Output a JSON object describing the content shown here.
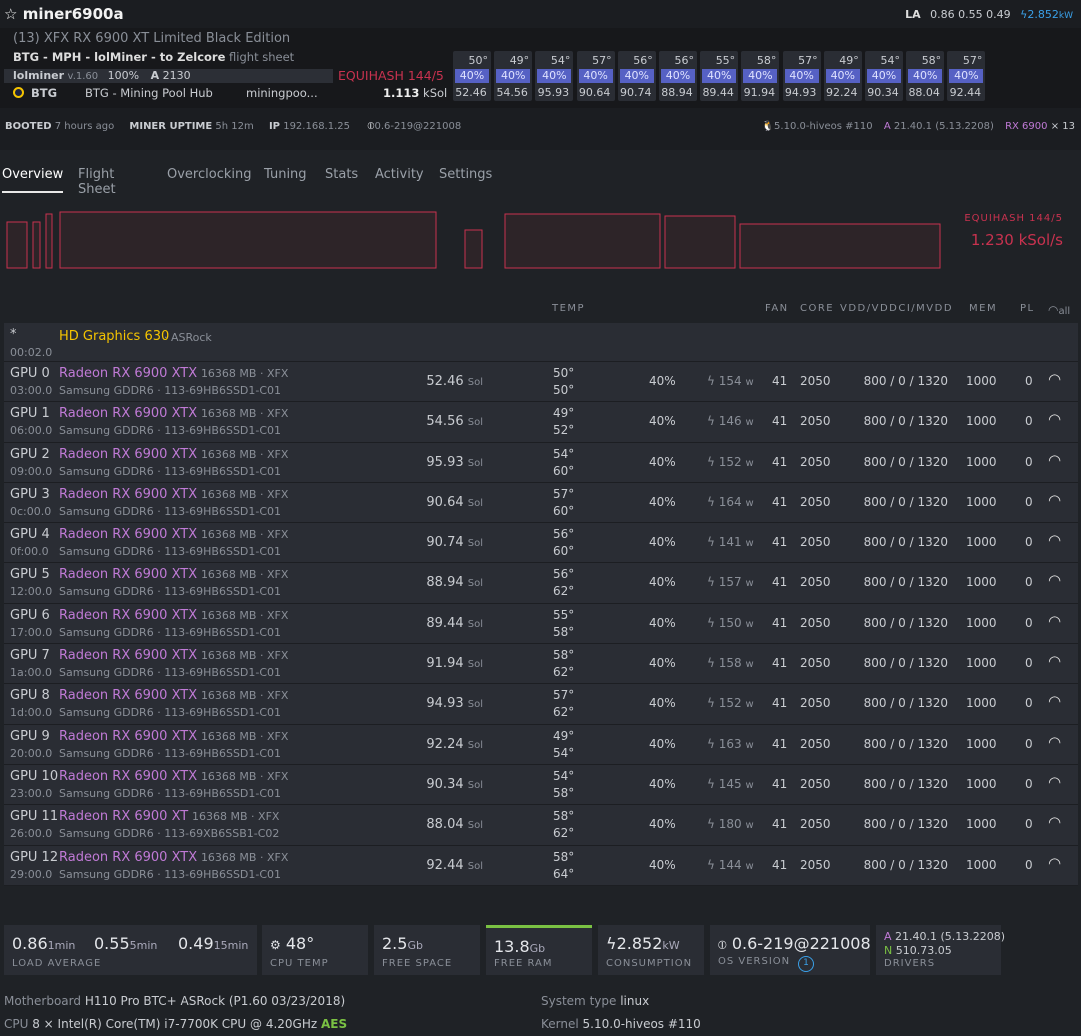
{
  "header": {
    "star_icon": "star-outline",
    "title": "miner6900a",
    "la_label": "LA",
    "la_values": "0.86 0.55 0.49",
    "power": "2.852",
    "power_unit": "kW"
  },
  "rig": {
    "model": "(13) XFX RX 6900 XT Limited Black Edition",
    "flight_sheet_name": "BTG - MPH - lolMiner - to Zelcore",
    "flight_sheet_suffix": "flight sheet",
    "miner": "lolminer",
    "miner_version": "v.1.60",
    "miner_percent": "100%",
    "accepted_label": "A",
    "accepted": "2130",
    "algo": "EQUIHASH 144/5",
    "coin": "BTG",
    "pool": "BTG - Mining Pool Hub",
    "pool_url": "miningpoo...",
    "hashrate": "1.113",
    "hashrate_unit": "kSol"
  },
  "status": {
    "booted_label": "BOOTED",
    "booted": "7 hours ago",
    "uptime_label": "MINER UPTIME",
    "uptime": "5h 12m",
    "ip_label": "IP",
    "ip": "192.168.1.25",
    "os": "0.6-219@221008",
    "kernel": "5.10.0-hiveos #110",
    "amd_label": "A",
    "amd_driver": "21.40.1 (5.13.2208)",
    "gpu_summary": "RX 6900",
    "gpu_count": "× 13"
  },
  "tiles": [
    {
      "temp": "50°",
      "fan": "40%",
      "hash": "52.46"
    },
    {
      "temp": "49°",
      "fan": "40%",
      "hash": "54.56"
    },
    {
      "temp": "54°",
      "fan": "40%",
      "hash": "95.93"
    },
    {
      "temp": "57°",
      "fan": "40%",
      "hash": "90.64"
    },
    {
      "temp": "56°",
      "fan": "40%",
      "hash": "90.74"
    },
    {
      "temp": "56°",
      "fan": "40%",
      "hash": "88.94"
    },
    {
      "temp": "55°",
      "fan": "40%",
      "hash": "89.44"
    },
    {
      "temp": "58°",
      "fan": "40%",
      "hash": "91.94"
    },
    {
      "temp": "57°",
      "fan": "40%",
      "hash": "94.93"
    },
    {
      "temp": "49°",
      "fan": "40%",
      "hash": "92.24"
    },
    {
      "temp": "54°",
      "fan": "40%",
      "hash": "90.34"
    },
    {
      "temp": "58°",
      "fan": "40%",
      "hash": "88.04"
    },
    {
      "temp": "57°",
      "fan": "40%",
      "hash": "92.44"
    }
  ],
  "tabs": [
    "Overview",
    "Flight Sheet",
    "Overclocking",
    "Tuning",
    "Stats",
    "Activity",
    "Settings"
  ],
  "graph": {
    "algo": "EQUIHASH 144/5",
    "hashrate": "1.230 kSol/s"
  },
  "columns": {
    "temp": "TEMP",
    "fan": "FAN",
    "core": "CORE",
    "vdd": "VDD/VDDCI/MVDD",
    "mem": "MEM",
    "pl": "PL",
    "all": "all"
  },
  "igpu": {
    "id": "*",
    "bus": "00:02.0",
    "name": "HD Graphics 630",
    "vendor": "· ASRock"
  },
  "gpus": [
    {
      "id": "GPU 0",
      "bus": "03:00.0",
      "name": "Radeon RX 6900 XTX",
      "mem": "16368 MB · XFX",
      "sub": "Samsung GDDR6 · 113-69HB6SSD1-C01",
      "hash": "52.46",
      "unit": "Sol",
      "t1": "50°",
      "t2": "50°",
      "fan": "40%",
      "power": "154",
      "fanv": "41",
      "core": "2050",
      "vdd": "800 / 0 / 1320",
      "memclk": "1000",
      "pl": "0"
    },
    {
      "id": "GPU 1",
      "bus": "06:00.0",
      "name": "Radeon RX 6900 XTX",
      "mem": "16368 MB · XFX",
      "sub": "Samsung GDDR6 · 113-69HB6SSD1-C01",
      "hash": "54.56",
      "unit": "Sol",
      "t1": "49°",
      "t2": "52°",
      "fan": "40%",
      "power": "146",
      "fanv": "41",
      "core": "2050",
      "vdd": "800 / 0 / 1320",
      "memclk": "1000",
      "pl": "0"
    },
    {
      "id": "GPU 2",
      "bus": "09:00.0",
      "name": "Radeon RX 6900 XTX",
      "mem": "16368 MB · XFX",
      "sub": "Samsung GDDR6 · 113-69HB6SSD1-C01",
      "hash": "95.93",
      "unit": "Sol",
      "t1": "54°",
      "t2": "60°",
      "fan": "40%",
      "power": "152",
      "fanv": "41",
      "core": "2050",
      "vdd": "800 / 0 / 1320",
      "memclk": "1000",
      "pl": "0"
    },
    {
      "id": "GPU 3",
      "bus": "0c:00.0",
      "name": "Radeon RX 6900 XTX",
      "mem": "16368 MB · XFX",
      "sub": "Samsung GDDR6 · 113-69HB6SSD1-C01",
      "hash": "90.64",
      "unit": "Sol",
      "t1": "57°",
      "t2": "60°",
      "fan": "40%",
      "power": "164",
      "fanv": "41",
      "core": "2050",
      "vdd": "800 / 0 / 1320",
      "memclk": "1000",
      "pl": "0"
    },
    {
      "id": "GPU 4",
      "bus": "0f:00.0",
      "name": "Radeon RX 6900 XTX",
      "mem": "16368 MB · XFX",
      "sub": "Samsung GDDR6 · 113-69HB6SSD1-C01",
      "hash": "90.74",
      "unit": "Sol",
      "t1": "56°",
      "t2": "60°",
      "fan": "40%",
      "power": "141",
      "fanv": "41",
      "core": "2050",
      "vdd": "800 / 0 / 1320",
      "memclk": "1000",
      "pl": "0"
    },
    {
      "id": "GPU 5",
      "bus": "12:00.0",
      "name": "Radeon RX 6900 XTX",
      "mem": "16368 MB · XFX",
      "sub": "Samsung GDDR6 · 113-69HB6SSD1-C01",
      "hash": "88.94",
      "unit": "Sol",
      "t1": "56°",
      "t2": "62°",
      "fan": "40%",
      "power": "157",
      "fanv": "41",
      "core": "2050",
      "vdd": "800 / 0 / 1320",
      "memclk": "1000",
      "pl": "0"
    },
    {
      "id": "GPU 6",
      "bus": "17:00.0",
      "name": "Radeon RX 6900 XTX",
      "mem": "16368 MB · XFX",
      "sub": "Samsung GDDR6 · 113-69HB6SSD1-C01",
      "hash": "89.44",
      "unit": "Sol",
      "t1": "55°",
      "t2": "58°",
      "fan": "40%",
      "power": "150",
      "fanv": "41",
      "core": "2050",
      "vdd": "800 / 0 / 1320",
      "memclk": "1000",
      "pl": "0"
    },
    {
      "id": "GPU 7",
      "bus": "1a:00.0",
      "name": "Radeon RX 6900 XTX",
      "mem": "16368 MB · XFX",
      "sub": "Samsung GDDR6 · 113-69HB6SSD1-C01",
      "hash": "91.94",
      "unit": "Sol",
      "t1": "58°",
      "t2": "62°",
      "fan": "40%",
      "power": "158",
      "fanv": "41",
      "core": "2050",
      "vdd": "800 / 0 / 1320",
      "memclk": "1000",
      "pl": "0"
    },
    {
      "id": "GPU 8",
      "bus": "1d:00.0",
      "name": "Radeon RX 6900 XTX",
      "mem": "16368 MB · XFX",
      "sub": "Samsung GDDR6 · 113-69HB6SSD1-C01",
      "hash": "94.93",
      "unit": "Sol",
      "t1": "57°",
      "t2": "62°",
      "fan": "40%",
      "power": "152",
      "fanv": "41",
      "core": "2050",
      "vdd": "800 / 0 / 1320",
      "memclk": "1000",
      "pl": "0"
    },
    {
      "id": "GPU 9",
      "bus": "20:00.0",
      "name": "Radeon RX 6900 XTX",
      "mem": "16368 MB · XFX",
      "sub": "Samsung GDDR6 · 113-69HB6SSD1-C01",
      "hash": "92.24",
      "unit": "Sol",
      "t1": "49°",
      "t2": "54°",
      "fan": "40%",
      "power": "163",
      "fanv": "41",
      "core": "2050",
      "vdd": "800 / 0 / 1320",
      "memclk": "1000",
      "pl": "0"
    },
    {
      "id": "GPU 10",
      "bus": "23:00.0",
      "name": "Radeon RX 6900 XTX",
      "mem": "16368 MB · XFX",
      "sub": "Samsung GDDR6 · 113-69HB6SSD1-C01",
      "hash": "90.34",
      "unit": "Sol",
      "t1": "54°",
      "t2": "58°",
      "fan": "40%",
      "power": "145",
      "fanv": "41",
      "core": "2050",
      "vdd": "800 / 0 / 1320",
      "memclk": "1000",
      "pl": "0"
    },
    {
      "id": "GPU 11",
      "bus": "26:00.0",
      "name": "Radeon RX 6900 XT",
      "mem": "16368 MB · XFX",
      "sub": "Samsung GDDR6 · 113-69XB6SSB1-C02",
      "hash": "88.04",
      "unit": "Sol",
      "t1": "58°",
      "t2": "62°",
      "fan": "40%",
      "power": "180",
      "fanv": "41",
      "core": "2050",
      "vdd": "800 / 0 / 1320",
      "memclk": "1000",
      "pl": "0"
    },
    {
      "id": "GPU 12",
      "bus": "29:00.0",
      "name": "Radeon RX 6900 XTX",
      "mem": "16368 MB · XFX",
      "sub": "Samsung GDDR6 · 113-69HB6SSD1-C01",
      "hash": "92.44",
      "unit": "Sol",
      "t1": "58°",
      "t2": "64°",
      "fan": "40%",
      "power": "144",
      "fanv": "41",
      "core": "2050",
      "vdd": "800 / 0 / 1320",
      "memclk": "1000",
      "pl": "0"
    }
  ],
  "stats": {
    "la1": "0.86",
    "la1u": "1min",
    "la5": "0.55",
    "la5u": "5min",
    "la15": "0.49",
    "la15u": "15min",
    "la_label": "LOAD AVERAGE",
    "cpu_temp": "48°",
    "cpu_temp_label": "CPU TEMP",
    "free_space": "2.5",
    "free_space_unit": "Gb",
    "free_space_label": "FREE SPACE",
    "free_ram": "13.8",
    "free_ram_unit": "Gb",
    "free_ram_label": "FREE RAM",
    "consumption": "2.852",
    "consumption_unit": "kW",
    "consumption_label": "CONSUMPTION",
    "os_version": "0.6-219@221008",
    "os_label": "OS VERSION",
    "os_updates": "1",
    "drv_a_label": "A",
    "drv_a": "21.40.1 (5.13.2208)",
    "drv_n_label": "N",
    "drv_n": "510.73.05",
    "drivers_label": "DRIVERS"
  },
  "system": {
    "mb_label": "Motherboard",
    "mb": "H110 Pro BTC+ ASRock (P1.60 03/23/2018)",
    "cpu_label": "CPU",
    "cpu": "8 × Intel(R) Core(TM) i7-7700K CPU @ 4.20GHz",
    "aes": "AES",
    "systype_label": "System type",
    "systype": "linux",
    "kernel_label": "Kernel",
    "kernel": "5.10.0-hiveos #110"
  },
  "colors": {
    "accent_red": "#c8324f",
    "purple": "#c07ad6",
    "yellow": "#f5c400",
    "fan_blue": "#5661c4",
    "green": "#7ac143",
    "link_blue": "#3aa0e8"
  }
}
